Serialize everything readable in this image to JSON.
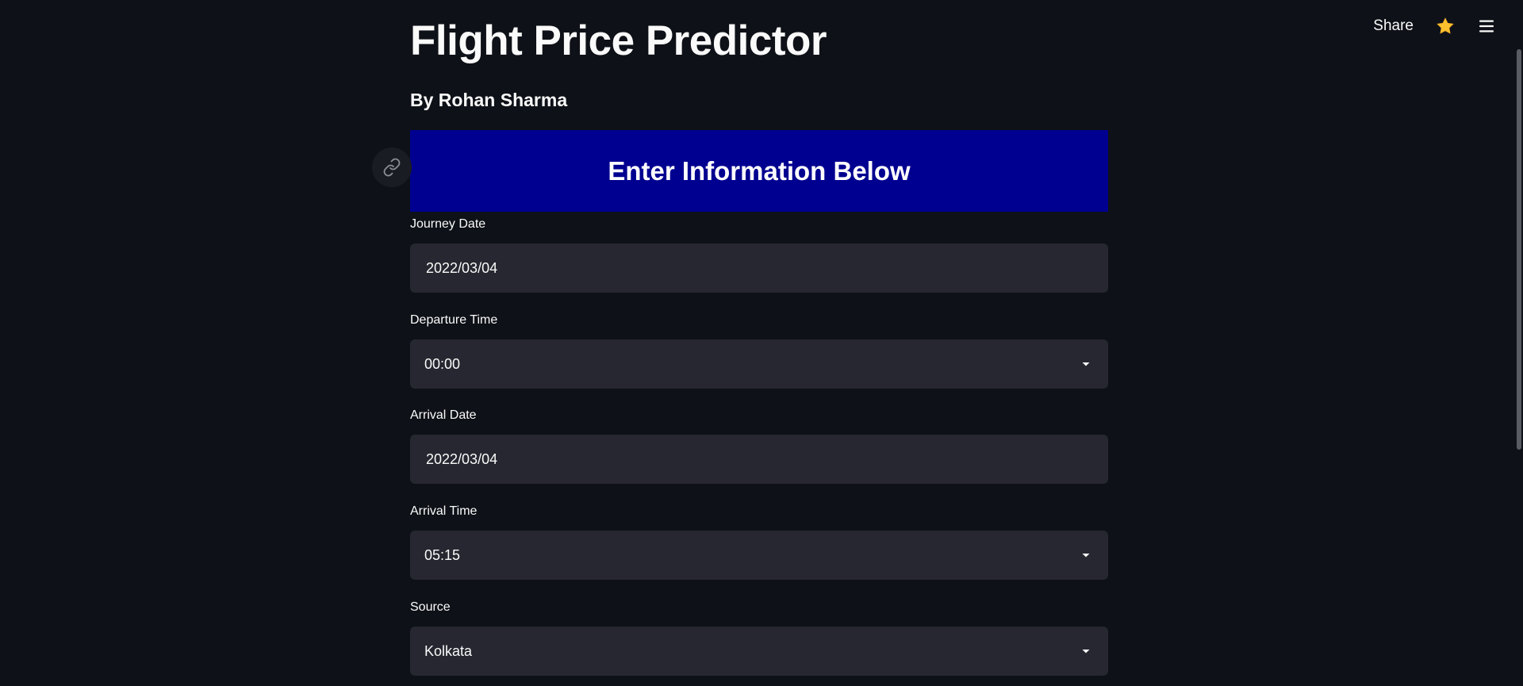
{
  "header": {
    "share_label": "Share",
    "star_icon": "star-icon",
    "menu_icon": "hamburger-menu-icon",
    "star_color": "#fbc02d"
  },
  "main": {
    "title": "Flight Price Predictor",
    "subtitle": "By Rohan Sharma",
    "banner": {
      "text": "Enter Information Below",
      "background": "#000090"
    },
    "fields": {
      "journey_date": {
        "label": "Journey Date",
        "value": "2022/03/04"
      },
      "departure_time": {
        "label": "Departure Time",
        "value": "00:00"
      },
      "arrival_date": {
        "label": "Arrival Date",
        "value": "2022/03/04"
      },
      "arrival_time": {
        "label": "Arrival Time",
        "value": "05:15"
      },
      "source": {
        "label": "Source",
        "value": "Kolkata"
      }
    }
  },
  "colors": {
    "background": "#0e1117",
    "input_background": "#262730",
    "text": "#fafafa"
  }
}
